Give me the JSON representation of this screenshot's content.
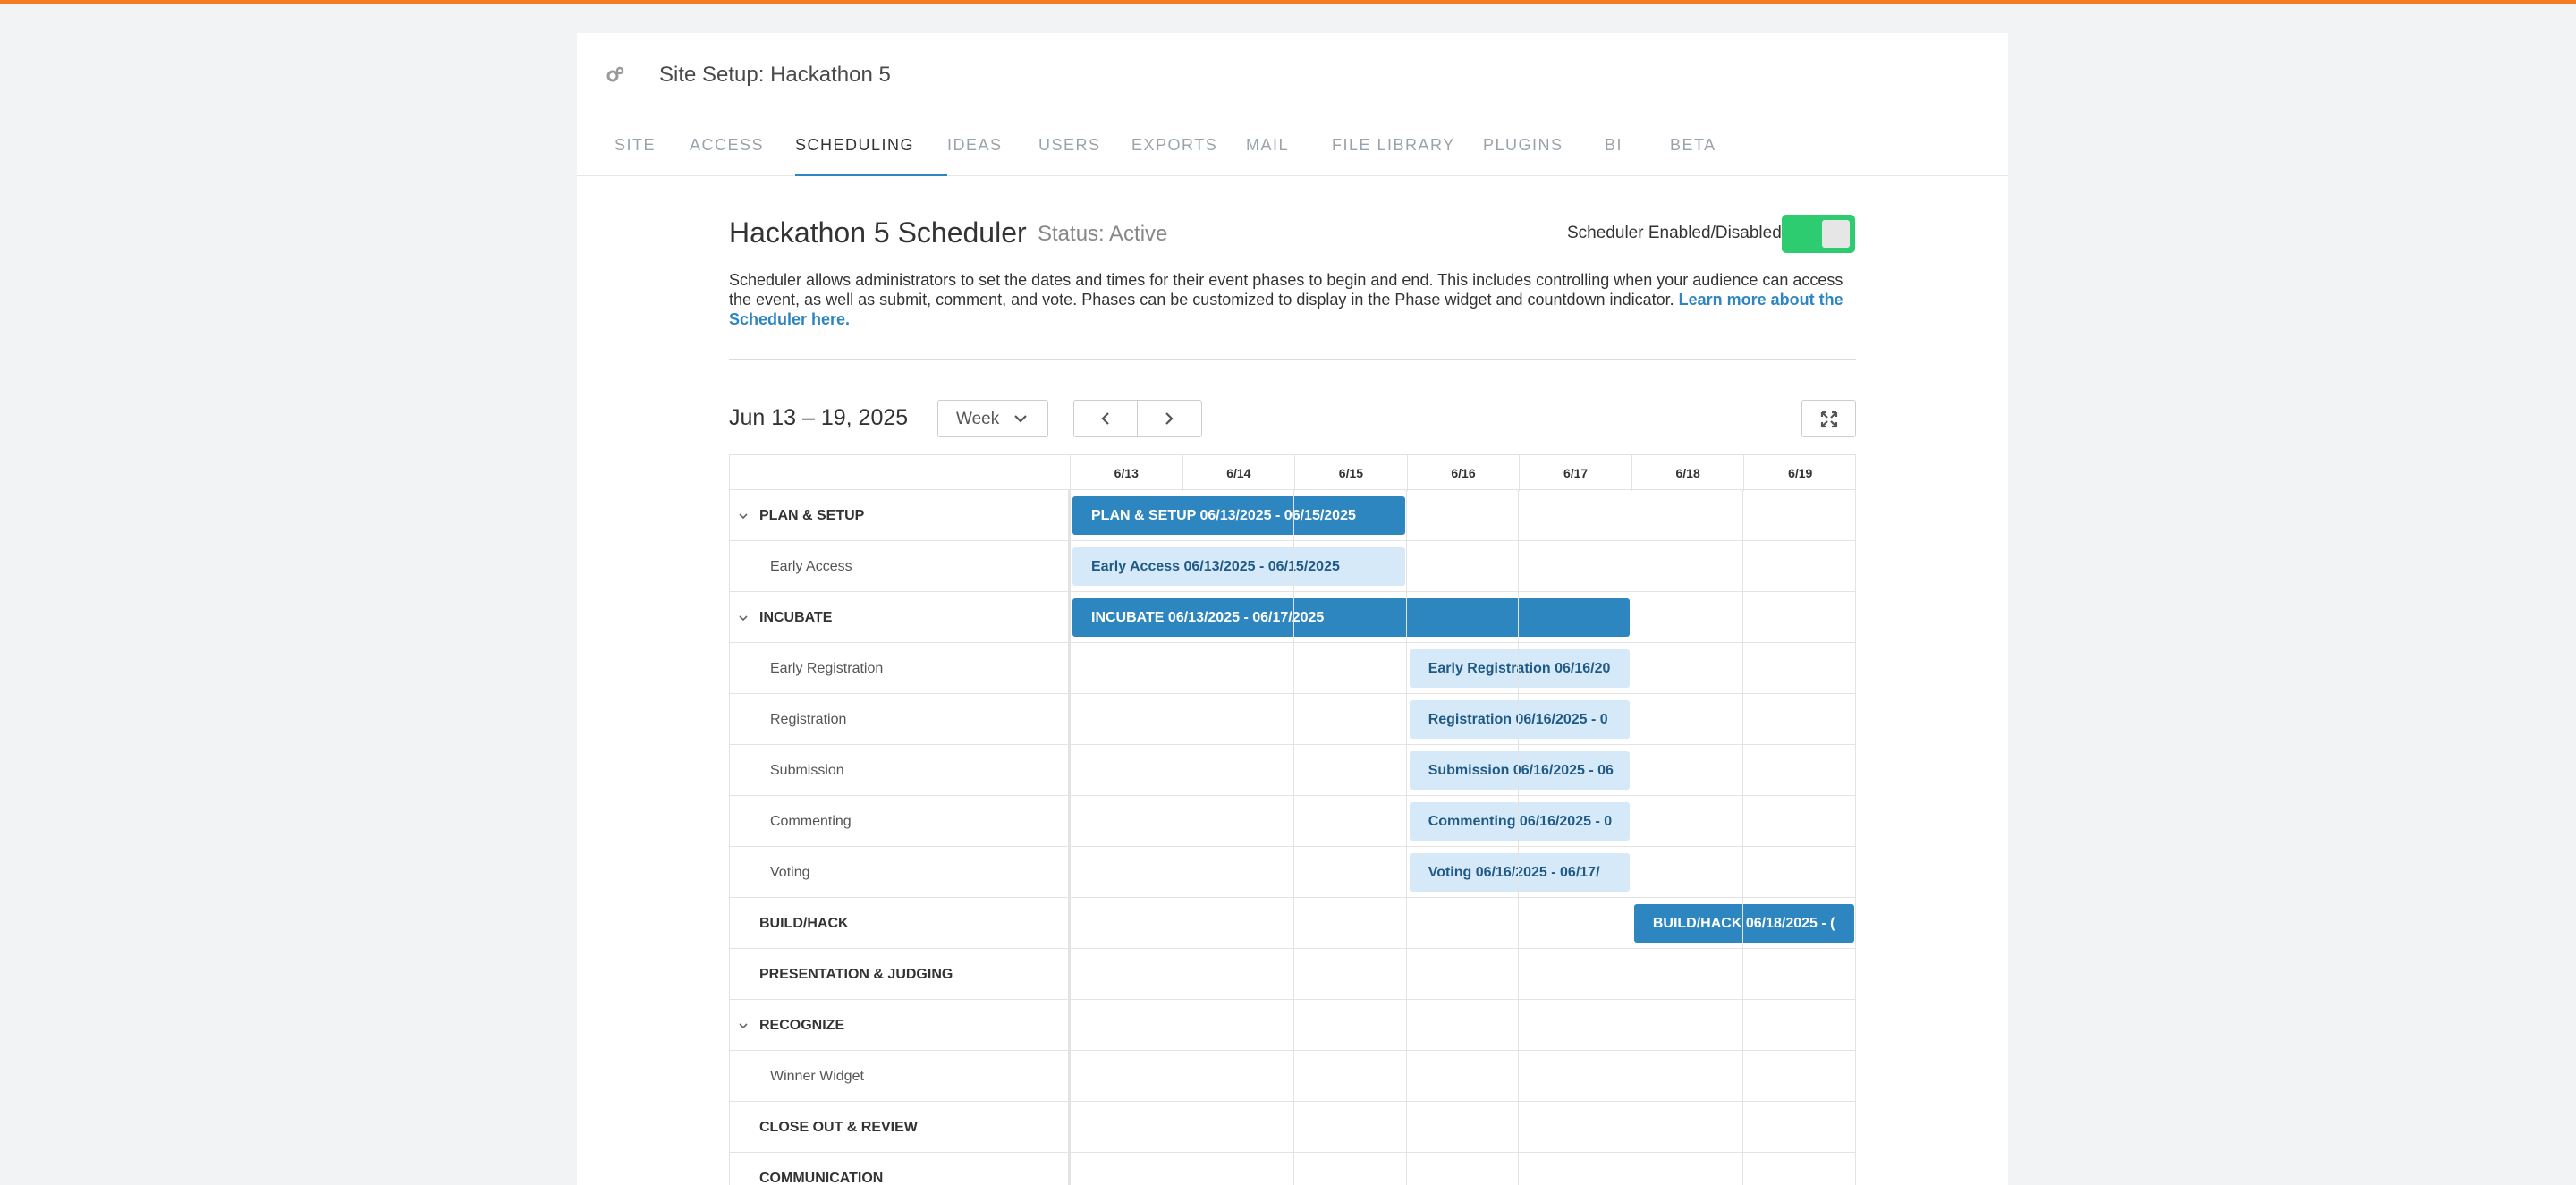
{
  "header": {
    "title": "Site Setup: Hackathon 5",
    "tabs": [
      {
        "label": "SITE"
      },
      {
        "label": "ACCESS"
      },
      {
        "label": "SCHEDULING",
        "active": true
      },
      {
        "label": "IDEAS"
      },
      {
        "label": "USERS"
      },
      {
        "label": "EXPORTS"
      },
      {
        "label": "MAIL"
      },
      {
        "label": "FILE LIBRARY"
      },
      {
        "label": "PLUGINS"
      },
      {
        "label": "BI"
      },
      {
        "label": "BETA"
      }
    ]
  },
  "scheduler": {
    "title": "Hackathon 5 Scheduler",
    "status": "Status: Active",
    "toggle_label": "Scheduler Enabled/Disabled",
    "enabled": true,
    "description": "Scheduler allows administrators to set the dates and times for their event phases to begin and end. This includes controlling when your audience can access the event, as well as submit, comment, and vote. Phases can be customized to display in the Phase widget and countdown indicator.",
    "learn_more": "Learn more about the Scheduler here."
  },
  "toolbar": {
    "range": "Jun 13 – 19, 2025",
    "view": "Week"
  },
  "calendar": {
    "days": [
      "6/13",
      "6/14",
      "6/15",
      "6/16",
      "6/17",
      "6/18",
      "6/19"
    ],
    "rows": [
      {
        "label": "PLAN & SETUP",
        "parent": true,
        "collapsible": true,
        "bar": {
          "text": "PLAN & SETUP 06/13/2025 - 06/15/2025",
          "start": 0,
          "end": 3,
          "style": "dark"
        }
      },
      {
        "label": "Early Access",
        "parent": false,
        "bar": {
          "text": "Early Access 06/13/2025 - 06/15/2025",
          "start": 0,
          "end": 3,
          "style": "light"
        }
      },
      {
        "label": "INCUBATE",
        "parent": true,
        "collapsible": true,
        "bar": {
          "text": "INCUBATE 06/13/2025 - 06/17/2025",
          "start": 0,
          "end": 5,
          "style": "dark"
        }
      },
      {
        "label": "Early Registration",
        "parent": false,
        "bar": {
          "text": "Early Registration 06/16/20",
          "start": 3,
          "end": 5,
          "style": "light"
        }
      },
      {
        "label": "Registration",
        "parent": false,
        "bar": {
          "text": "Registration 06/16/2025 - 0",
          "start": 3,
          "end": 5,
          "style": "light"
        }
      },
      {
        "label": "Submission",
        "parent": false,
        "bar": {
          "text": "Submission 06/16/2025 - 06",
          "start": 3,
          "end": 5,
          "style": "light"
        }
      },
      {
        "label": "Commenting",
        "parent": false,
        "bar": {
          "text": "Commenting 06/16/2025 - 0",
          "start": 3,
          "end": 5,
          "style": "light"
        }
      },
      {
        "label": "Voting",
        "parent": false,
        "bar": {
          "text": "Voting 06/16/2025 - 06/17/",
          "start": 3,
          "end": 5,
          "style": "light"
        }
      },
      {
        "label": "BUILD/HACK",
        "parent": true,
        "collapsible": false,
        "bar": {
          "text": "BUILD/HACK 06/18/2025 - (",
          "start": 5,
          "end": 7,
          "style": "dark"
        }
      },
      {
        "label": "PRESENTATION & JUDGING",
        "parent": true,
        "collapsible": false
      },
      {
        "label": "RECOGNIZE",
        "parent": true,
        "collapsible": true
      },
      {
        "label": "Winner Widget",
        "parent": false
      },
      {
        "label": "CLOSE OUT & REVIEW",
        "parent": true,
        "collapsible": false
      },
      {
        "label": "COMMUNICATION",
        "parent": true,
        "collapsible": false
      }
    ]
  }
}
